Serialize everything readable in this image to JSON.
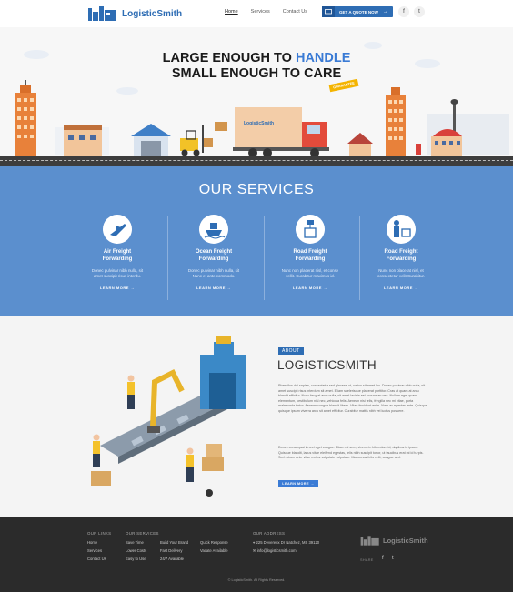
{
  "brand": {
    "name": "LogisticSmith"
  },
  "nav": {
    "links": [
      {
        "label": "Home",
        "active": true
      },
      {
        "label": "Services",
        "active": false
      },
      {
        "label": "Contact Us",
        "active": false
      }
    ],
    "quote_button": "GET A QUOTE NOW",
    "social": [
      "f",
      "t"
    ]
  },
  "hero": {
    "line1_prefix": "LARGE ENOUGH TO ",
    "line1_highlight": "HANDLE",
    "line2": "SMALL ENOUGH TO CARE",
    "badge": "GUARANTEE",
    "truck_label": "LogisticSmith"
  },
  "services": {
    "title": "OUR SERVICES",
    "items": [
      {
        "title1": "Air Freight",
        "title2": "Forwarding",
        "desc1": "Donec pulvinar nibh nulla, sit",
        "desc2": "amet suscipit risus interdu.",
        "link": "LEARN MORE",
        "icon": "airplane-icon"
      },
      {
        "title1": "Ocean Freight",
        "title2": "Forwarding",
        "desc1": "Donec pulvinar nibh nulla, sit",
        "desc2": "Nunc et ante commodo.",
        "link": "LEARN MORE",
        "icon": "ship-icon"
      },
      {
        "title1": "Road Freight",
        "title2": "Forwarding",
        "desc1": "Nunc non placerat nisl, et conse",
        "desc2": "vellit. Curabitur maximus id.",
        "link": "LEARN MORE",
        "icon": "crane-box-icon"
      },
      {
        "title1": "Road Freight",
        "title2": "Forwarding",
        "desc1": "Nunc non placerat nisl, et",
        "desc2": "consectetur velit Curabitur.",
        "link": "LEARN MORE",
        "icon": "worker-box-icon"
      }
    ]
  },
  "about": {
    "tag": "ABOUT",
    "title": "LOGISTICSMITH",
    "para1": "Phasellus dui sapien, consectetur sed placerat ut, varius sit amet leo. Donec pulvinar nibh nulla, sit amet suscipit risus interdum sit amet. Etiam scelerisque placerat porttitor. Cras at quam at arcu blandit efficitur. Nunc feugiat arcu nulla, sit amet lacinia est accumsan nec. Nullam eget quam elementum, vestibulum nisl nec, vehicula felis. Aenean nisi felis, fringilla nec mi vitae, porta malesuada tortor. Aenean congue blandit libero. Vitae tincidunt enim. Nam ac egestas ante. Quisque quisque ipsum viverra arcu sit amet efficitur. Curabitur mattis nibh vel luctus posuere.",
    "para2": "Donec consequat in orci eget congue. Etiam mi sem, viverra in bibendum id, dapibus in ipsum. Quisque blandit, lacus vitae eleifend egestas, felis nibh suscipit tortor, ut faucibus erat mi id turpis. Sed rutrum ante vitae metus vulputate vulputate. Maecenas felis velit, congue sed.",
    "button": "LEARN MORE"
  },
  "footer": {
    "links_head": "OUR LINKS",
    "links": [
      "Home",
      "Services",
      "Contact Us"
    ],
    "services_head": "OUR SERVICES",
    "services_col1": [
      "Save Time",
      "Lower Costs",
      "Easy to Use"
    ],
    "services_col2": [
      "Build Your Brand",
      "Fast Delivery",
      "24/7 Available"
    ],
    "services_col3": [
      "Quick Response",
      "Vacate Available"
    ],
    "address_head": "OUR ADDRESS",
    "address": "225 Devereux Dr Natchez, MS 39120",
    "email": "info@logisticsmith.com",
    "share": "SHARE",
    "copyright": "© LogisticSmith. All Rights Reserved."
  },
  "colors": {
    "brand_blue": "#2e6db4",
    "services_bg": "#5b8fce",
    "footer_bg": "#2b2b2b",
    "accent_yellow": "#f4b400"
  }
}
